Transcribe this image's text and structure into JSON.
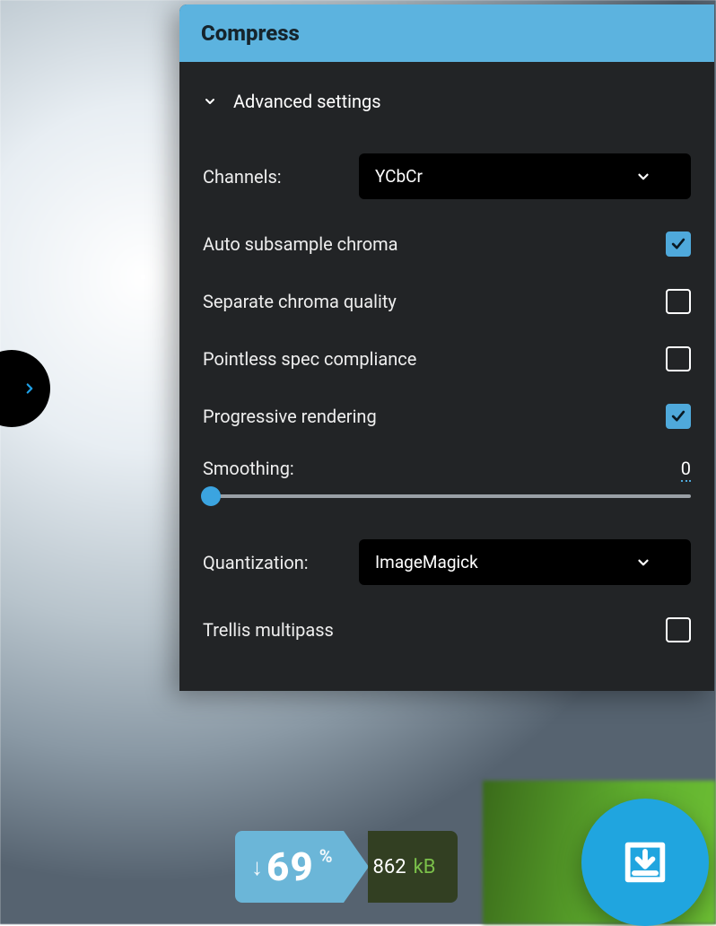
{
  "panel": {
    "title": "Compress",
    "section_label": "Advanced settings",
    "channels_label": "Channels:",
    "channels_value": "YCbCr",
    "opts": {
      "auto_subsample": {
        "label": "Auto subsample chroma",
        "checked": true
      },
      "sep_chroma": {
        "label": "Separate chroma quality",
        "checked": false
      },
      "spec_comp": {
        "label": "Pointless spec compliance",
        "checked": false
      },
      "progressive": {
        "label": "Progressive rendering",
        "checked": true
      },
      "trellis": {
        "label": "Trellis multipass",
        "checked": false
      }
    },
    "smoothing_label": "Smoothing:",
    "smoothing_value": "0",
    "quant_label": "Quantization:",
    "quant_value": "ImageMagick"
  },
  "footer": {
    "reduction_pct": "69",
    "pct_symbol": "%",
    "size_value": "862",
    "size_unit": "kB"
  },
  "colors": {
    "accent": "#4fa9db",
    "header": "#5cb3df"
  }
}
